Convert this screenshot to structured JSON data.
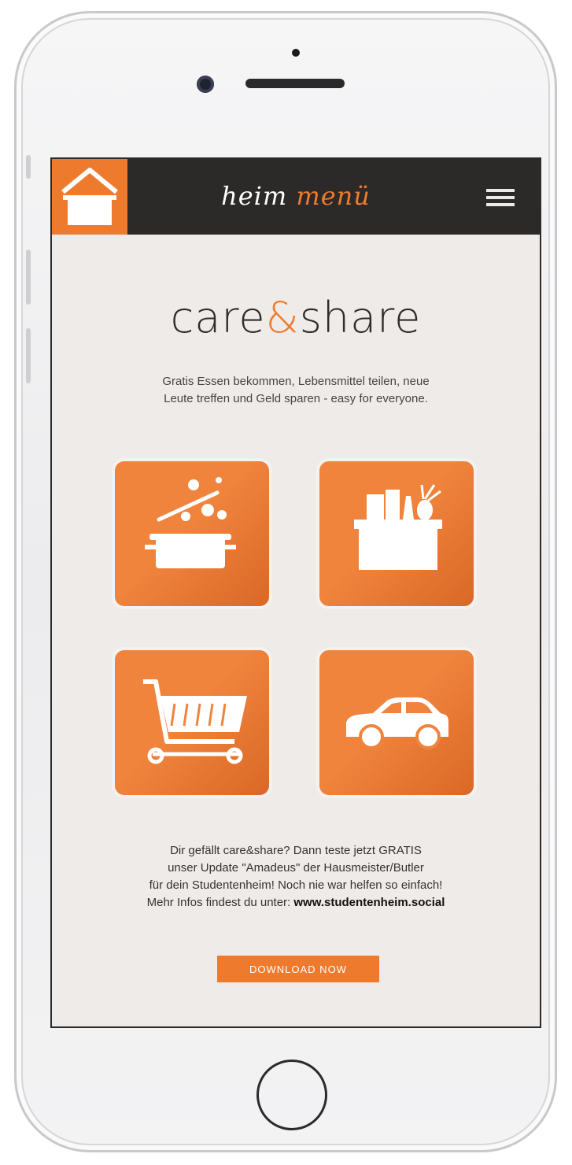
{
  "header": {
    "logo_part1": "heim",
    "logo_part2": "menü"
  },
  "hero": {
    "title_part1": "care",
    "title_amp": "&",
    "title_part2": "share",
    "intro_line1": "Gratis Essen bekommen, Lebensmittel teilen, neue",
    "intro_line2": "Leute treffen und Geld sparen - easy for everyone."
  },
  "tiles": [
    {
      "icon": "cooking-pot-icon"
    },
    {
      "icon": "grocery-basket-icon"
    },
    {
      "icon": "shopping-cart-icon"
    },
    {
      "icon": "car-icon"
    }
  ],
  "promo": {
    "line1": "Dir gefällt care&share? Dann teste jetzt GRATIS",
    "line2": "unser Update \"Amadeus\" der Hausmeister/Butler",
    "line3": "für dein Studentenheim! Noch nie war helfen so einfach!",
    "line4_prefix": "Mehr Infos findest du unter: ",
    "line4_link": "www.studentenheim.social"
  },
  "download_button": "DOWNLOAD NOW",
  "colors": {
    "accent": "#ee7a2d",
    "navbar": "#2c2a29",
    "screen_bg": "#efebe8"
  }
}
